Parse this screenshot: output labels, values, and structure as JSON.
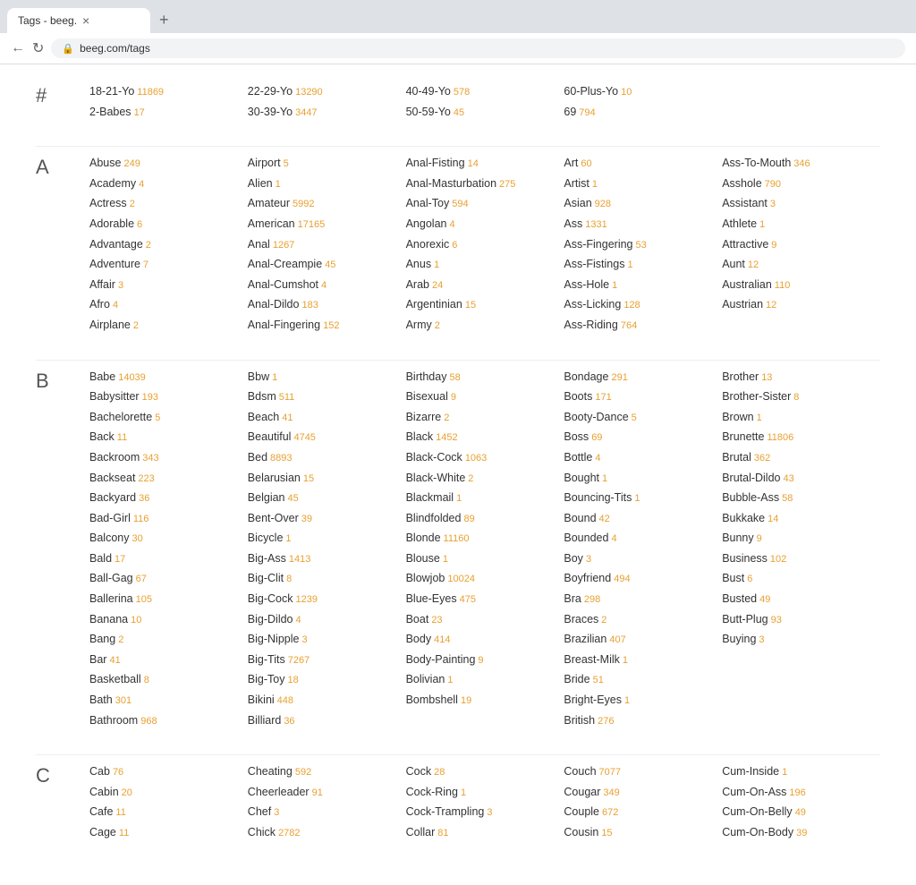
{
  "browser": {
    "tab_title": "Tags - beeg.",
    "address": "beeg.com/tags",
    "tab_close": "×",
    "tab_new": "+"
  },
  "sections": [
    {
      "letter": "#",
      "columns": [
        [
          {
            "name": "18-21-Yo",
            "count": "11869"
          },
          {
            "name": "2-Babes",
            "count": "17"
          }
        ],
        [
          {
            "name": "22-29-Yo",
            "count": "13290"
          },
          {
            "name": "30-39-Yo",
            "count": "3447"
          }
        ],
        [
          {
            "name": "40-49-Yo",
            "count": "578"
          },
          {
            "name": "50-59-Yo",
            "count": "45"
          }
        ],
        [
          {
            "name": "60-Plus-Yo",
            "count": "10"
          },
          {
            "name": "69",
            "count": "794"
          }
        ],
        []
      ]
    },
    {
      "letter": "A",
      "columns": [
        [
          {
            "name": "Abuse",
            "count": "249"
          },
          {
            "name": "Academy",
            "count": "4"
          },
          {
            "name": "Actress",
            "count": "2"
          },
          {
            "name": "Adorable",
            "count": "6"
          },
          {
            "name": "Advantage",
            "count": "2"
          },
          {
            "name": "Adventure",
            "count": "7"
          },
          {
            "name": "Affair",
            "count": "3"
          },
          {
            "name": "Afro",
            "count": "4"
          },
          {
            "name": "Airplane",
            "count": "2"
          }
        ],
        [
          {
            "name": "Airport",
            "count": "5"
          },
          {
            "name": "Alien",
            "count": "1"
          },
          {
            "name": "Amateur",
            "count": "5992"
          },
          {
            "name": "American",
            "count": "17165"
          },
          {
            "name": "Anal",
            "count": "1267"
          },
          {
            "name": "Anal-Creampie",
            "count": "45"
          },
          {
            "name": "Anal-Cumshot",
            "count": "4"
          },
          {
            "name": "Anal-Dildo",
            "count": "183"
          },
          {
            "name": "Anal-Fingering",
            "count": "152"
          }
        ],
        [
          {
            "name": "Anal-Fisting",
            "count": "14"
          },
          {
            "name": "Anal-Masturbation",
            "count": "275"
          },
          {
            "name": "Anal-Toy",
            "count": "594"
          },
          {
            "name": "Angolan",
            "count": "4"
          },
          {
            "name": "Anorexic",
            "count": "6"
          },
          {
            "name": "Anus",
            "count": "1"
          },
          {
            "name": "Arab",
            "count": "24"
          },
          {
            "name": "Argentinian",
            "count": "15"
          },
          {
            "name": "Army",
            "count": "2"
          }
        ],
        [
          {
            "name": "Art",
            "count": "60"
          },
          {
            "name": "Artist",
            "count": "1"
          },
          {
            "name": "Asian",
            "count": "928"
          },
          {
            "name": "Ass",
            "count": "1331"
          },
          {
            "name": "Ass-Fingering",
            "count": "53"
          },
          {
            "name": "Ass-Fistings",
            "count": "1"
          },
          {
            "name": "Ass-Hole",
            "count": "1"
          },
          {
            "name": "Ass-Licking",
            "count": "128"
          },
          {
            "name": "Ass-Riding",
            "count": "764"
          }
        ],
        [
          {
            "name": "Ass-To-Mouth",
            "count": "346"
          },
          {
            "name": "Asshole",
            "count": "790"
          },
          {
            "name": "Assistant",
            "count": "3"
          },
          {
            "name": "Athlete",
            "count": "1"
          },
          {
            "name": "Attractive",
            "count": "9"
          },
          {
            "name": "Aunt",
            "count": "12"
          },
          {
            "name": "Australian",
            "count": "110"
          },
          {
            "name": "Austrian",
            "count": "12"
          }
        ]
      ]
    },
    {
      "letter": "B",
      "columns": [
        [
          {
            "name": "Babe",
            "count": "14039"
          },
          {
            "name": "Babysitter",
            "count": "193"
          },
          {
            "name": "Bachelorette",
            "count": "5"
          },
          {
            "name": "Back",
            "count": "11"
          },
          {
            "name": "Backroom",
            "count": "343"
          },
          {
            "name": "Backseat",
            "count": "223"
          },
          {
            "name": "Backyard",
            "count": "36"
          },
          {
            "name": "Bad-Girl",
            "count": "116"
          },
          {
            "name": "Balcony",
            "count": "30"
          },
          {
            "name": "Bald",
            "count": "17"
          },
          {
            "name": "Ball-Gag",
            "count": "67"
          },
          {
            "name": "Ballerina",
            "count": "105"
          },
          {
            "name": "Banana",
            "count": "10"
          },
          {
            "name": "Bang",
            "count": "2"
          },
          {
            "name": "Bar",
            "count": "41"
          },
          {
            "name": "Basketball",
            "count": "8"
          },
          {
            "name": "Bath",
            "count": "301"
          },
          {
            "name": "Bathroom",
            "count": "968"
          }
        ],
        [
          {
            "name": "Bbw",
            "count": "1"
          },
          {
            "name": "Bdsm",
            "count": "511"
          },
          {
            "name": "Beach",
            "count": "41"
          },
          {
            "name": "Beautiful",
            "count": "4745"
          },
          {
            "name": "Bed",
            "count": "8893"
          },
          {
            "name": "Belarusian",
            "count": "15"
          },
          {
            "name": "Belgian",
            "count": "45"
          },
          {
            "name": "Bent-Over",
            "count": "39"
          },
          {
            "name": "Bicycle",
            "count": "1"
          },
          {
            "name": "Big-Ass",
            "count": "1413"
          },
          {
            "name": "Big-Clit",
            "count": "8"
          },
          {
            "name": "Big-Cock",
            "count": "1239"
          },
          {
            "name": "Big-Dildo",
            "count": "4"
          },
          {
            "name": "Big-Nipple",
            "count": "3"
          },
          {
            "name": "Big-Tits",
            "count": "7267"
          },
          {
            "name": "Big-Toy",
            "count": "18"
          },
          {
            "name": "Bikini",
            "count": "448"
          },
          {
            "name": "Billiard",
            "count": "36"
          }
        ],
        [
          {
            "name": "Birthday",
            "count": "58"
          },
          {
            "name": "Bisexual",
            "count": "9"
          },
          {
            "name": "Bizarre",
            "count": "2"
          },
          {
            "name": "Black",
            "count": "1452"
          },
          {
            "name": "Black-Cock",
            "count": "1063"
          },
          {
            "name": "Black-White",
            "count": "2"
          },
          {
            "name": "Blackmail",
            "count": "1"
          },
          {
            "name": "Blindfolded",
            "count": "89"
          },
          {
            "name": "Blonde",
            "count": "11160"
          },
          {
            "name": "Blouse",
            "count": "1"
          },
          {
            "name": "Blowjob",
            "count": "10024"
          },
          {
            "name": "Blue-Eyes",
            "count": "475"
          },
          {
            "name": "Boat",
            "count": "23"
          },
          {
            "name": "Body",
            "count": "414"
          },
          {
            "name": "Body-Painting",
            "count": "9"
          },
          {
            "name": "Bolivian",
            "count": "1"
          },
          {
            "name": "Bombshell",
            "count": "19"
          }
        ],
        [
          {
            "name": "Bondage",
            "count": "291"
          },
          {
            "name": "Boots",
            "count": "171"
          },
          {
            "name": "Booty-Dance",
            "count": "5"
          },
          {
            "name": "Boss",
            "count": "69"
          },
          {
            "name": "Bottle",
            "count": "4"
          },
          {
            "name": "Bought",
            "count": "1"
          },
          {
            "name": "Bouncing-Tits",
            "count": "1"
          },
          {
            "name": "Bound",
            "count": "42"
          },
          {
            "name": "Bounded",
            "count": "4"
          },
          {
            "name": "Boy",
            "count": "3"
          },
          {
            "name": "Boyfriend",
            "count": "494"
          },
          {
            "name": "Bra",
            "count": "298"
          },
          {
            "name": "Braces",
            "count": "2"
          },
          {
            "name": "Brazilian",
            "count": "407"
          },
          {
            "name": "Breast-Milk",
            "count": "1"
          },
          {
            "name": "Bride",
            "count": "51"
          },
          {
            "name": "Bright-Eyes",
            "count": "1"
          },
          {
            "name": "British",
            "count": "276"
          }
        ],
        [
          {
            "name": "Brother",
            "count": "13"
          },
          {
            "name": "Brother-Sister",
            "count": "8"
          },
          {
            "name": "Brown",
            "count": "1"
          },
          {
            "name": "Brunette",
            "count": "11806"
          },
          {
            "name": "Brutal",
            "count": "362"
          },
          {
            "name": "Brutal-Dildo",
            "count": "43"
          },
          {
            "name": "Bubble-Ass",
            "count": "58"
          },
          {
            "name": "Bukkake",
            "count": "14"
          },
          {
            "name": "Bunny",
            "count": "9"
          },
          {
            "name": "Business",
            "count": "102"
          },
          {
            "name": "Bust",
            "count": "6"
          },
          {
            "name": "Busted",
            "count": "49"
          },
          {
            "name": "Butt-Plug",
            "count": "93"
          },
          {
            "name": "Buying",
            "count": "3"
          }
        ]
      ]
    },
    {
      "letter": "C",
      "columns": [
        [
          {
            "name": "Cab",
            "count": "76"
          },
          {
            "name": "Cabin",
            "count": "20"
          },
          {
            "name": "Cafe",
            "count": "11"
          },
          {
            "name": "Cage",
            "count": "11"
          }
        ],
        [
          {
            "name": "Cheating",
            "count": "592"
          },
          {
            "name": "Cheerleader",
            "count": "91"
          },
          {
            "name": "Chef",
            "count": "3"
          },
          {
            "name": "Chick",
            "count": "2782"
          }
        ],
        [
          {
            "name": "Cock",
            "count": "28"
          },
          {
            "name": "Cock-Ring",
            "count": "1"
          },
          {
            "name": "Cock-Trampling",
            "count": "3"
          },
          {
            "name": "Collar",
            "count": "81"
          }
        ],
        [
          {
            "name": "Couch",
            "count": "7077"
          },
          {
            "name": "Cougar",
            "count": "349"
          },
          {
            "name": "Couple",
            "count": "672"
          },
          {
            "name": "Cousin",
            "count": "15"
          }
        ],
        [
          {
            "name": "Cum-Inside",
            "count": "1"
          },
          {
            "name": "Cum-On-Ass",
            "count": "196"
          },
          {
            "name": "Cum-On-Belly",
            "count": "49"
          },
          {
            "name": "Cum-On-Body",
            "count": "39"
          }
        ]
      ]
    }
  ]
}
